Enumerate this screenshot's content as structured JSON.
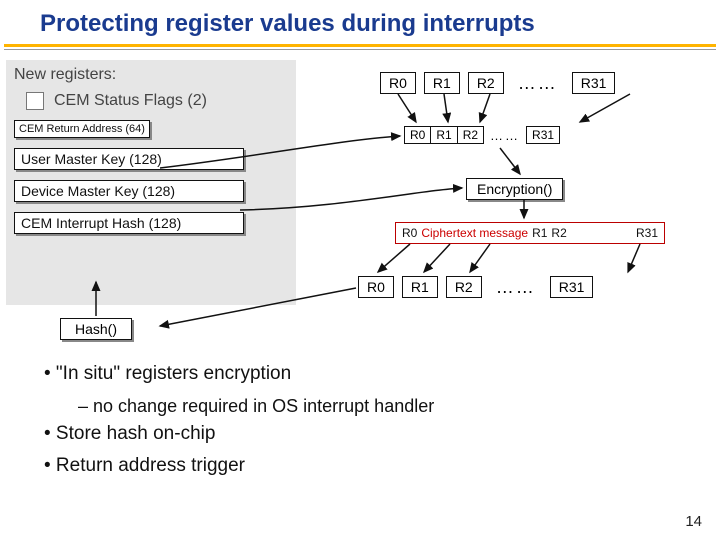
{
  "title": "Protecting register values during interrupts",
  "panel": {
    "heading": "New registers:",
    "flags": "CEM Status Flags (2)",
    "return_addr": "CEM Return Address (64)",
    "user_key": "User Master Key (128)",
    "device_key": "Device Master Key (128)",
    "int_hash": "CEM Interrupt Hash (128)"
  },
  "regs": {
    "r0": "R0",
    "r1": "R1",
    "r2": "R2",
    "r31": "R31",
    "dots": "……"
  },
  "encryption": "Encryption()",
  "cipher": {
    "r0": "R0",
    "r1": "R1",
    "r2": "R2",
    "r31": "R31",
    "text": "Ciphertext message"
  },
  "hash": "Hash()",
  "bullets": {
    "b1": "• \"In situ\" registers encryption",
    "b1s": "– no change required in OS interrupt handler",
    "b2": "• Store hash on-chip",
    "b3": "• Return address trigger"
  },
  "page": "14"
}
